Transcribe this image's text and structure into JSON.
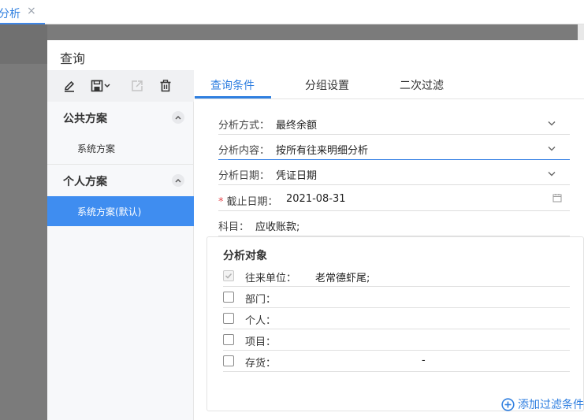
{
  "window_tab": {
    "label": "分析",
    "close_glyph": "×"
  },
  "dialog": {
    "title": "查询",
    "toolbar": {
      "icons": [
        "edit-icon",
        "save-icon",
        "export-icon",
        "delete-icon"
      ]
    },
    "schemes": {
      "public": {
        "title": "公共方案",
        "items": [
          "系统方案"
        ]
      },
      "personal": {
        "title": "个人方案",
        "items": [
          "系统方案(默认)"
        ]
      }
    },
    "tabs": [
      "查询条件",
      "分组设置",
      "二次过滤"
    ],
    "form": {
      "method": {
        "label": "分析方式：",
        "value": "最终余额"
      },
      "content": {
        "label": "分析内容：",
        "value": "按所有往来明细分析"
      },
      "date_type": {
        "label": "分析日期：",
        "value": "凭证日期"
      },
      "end_date": {
        "required_mark": "*",
        "label": "截止日期：",
        "value": "2021-08-31"
      },
      "subject": {
        "label": "科目：",
        "value": "应收账款;"
      }
    },
    "objects": {
      "title": "分析对象",
      "rows": [
        {
          "label": "往来单位：",
          "value": "老常德虾尾;",
          "checked": true
        },
        {
          "label": "部门：",
          "value": "",
          "checked": false
        },
        {
          "label": "个人：",
          "value": "",
          "checked": false
        },
        {
          "label": "项目：",
          "value": "",
          "checked": false
        },
        {
          "label": "存货：",
          "value": "-",
          "checked": false
        }
      ]
    },
    "add_filter_label": "添加过滤条件"
  }
}
